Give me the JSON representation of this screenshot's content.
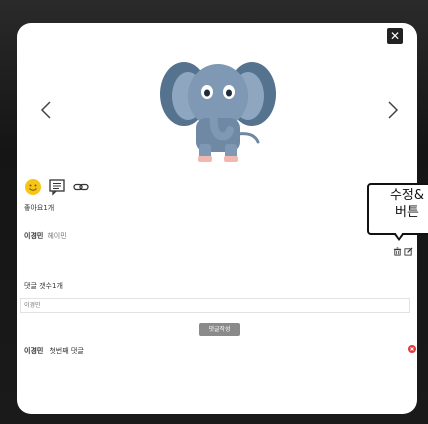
{
  "modal": {
    "close_label": "✕",
    "prev_label": "‹",
    "next_label": "›"
  },
  "post": {
    "likes_text": "좋아요1개",
    "author_name": "이경민",
    "author_nick": "헤이민"
  },
  "tooltip": {
    "line1": "수정&",
    "line2": "버튼"
  },
  "comments": {
    "count_text": "댓글 갯수1개",
    "input_placeholder": "이경민",
    "submit_label": "댓글작성",
    "items": [
      {
        "author": "이경민",
        "text": "첫번째 댓글"
      }
    ]
  },
  "colors": {
    "like_emoji": "#f5c518",
    "delete": "#e23a3a",
    "elephant_body": "#7f98b3"
  }
}
